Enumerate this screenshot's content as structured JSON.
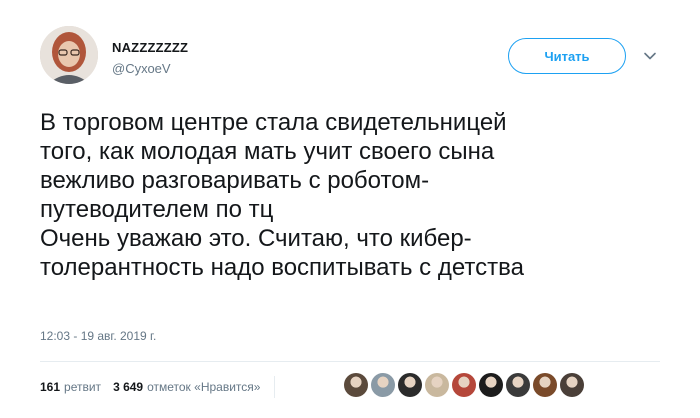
{
  "user": {
    "name": "NAZZZZZZZ",
    "handle": "@СухоеV"
  },
  "follow_button": {
    "label": "Читать"
  },
  "tweet": {
    "lines": [
      "В торговом центре стала свидетельницей",
      "того, как молодая мать учит своего сына",
      "вежливо разговаривать с роботом-",
      "путеводителем по тц",
      "Очень уважаю это. Считаю, что кибер-",
      "толерантность надо воспитывать с детства"
    ],
    "timestamp": "12:03 - 19 авг. 2019 г."
  },
  "stats": {
    "retweets_count": "161",
    "retweets_label": "ретвит",
    "likes_count": "3 649",
    "likes_label": "отметок «Нравится»"
  },
  "liker_avatars": [
    {
      "color": "#5b4a3c"
    },
    {
      "color": "#8a9aa6"
    },
    {
      "color": "#2b2b2b"
    },
    {
      "color": "#c9b89e"
    },
    {
      "color": "#b5473a"
    },
    {
      "color": "#1c1c1c"
    },
    {
      "color": "#3a3a3a"
    },
    {
      "color": "#7a4a2a"
    },
    {
      "color": "#4a3f38"
    }
  ]
}
